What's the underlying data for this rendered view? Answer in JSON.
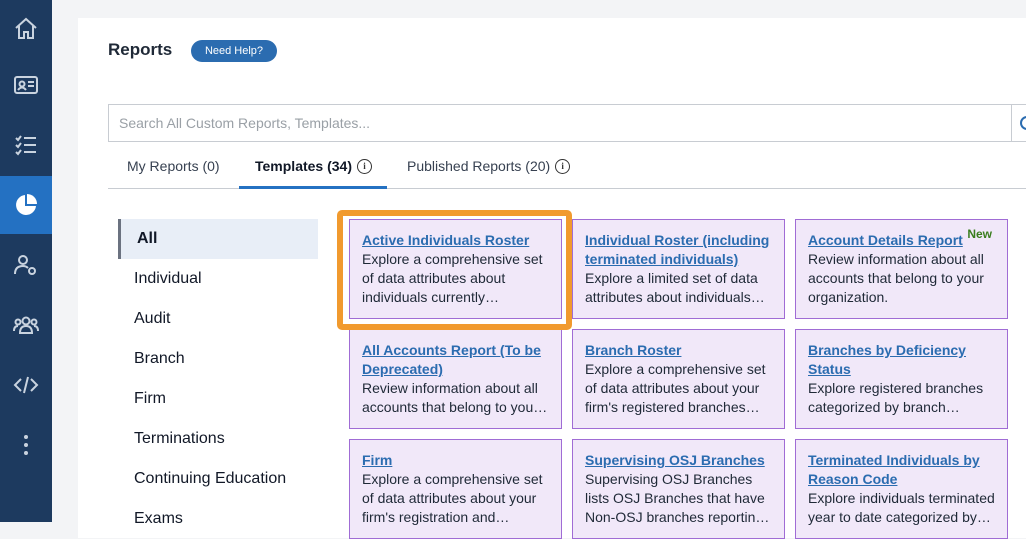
{
  "nav": {
    "items": [
      {
        "icon": "home-icon"
      },
      {
        "icon": "id-card-icon"
      },
      {
        "icon": "checklist-icon"
      },
      {
        "icon": "pie-chart-icon"
      },
      {
        "icon": "user-settings-icon"
      },
      {
        "icon": "users-group-icon"
      },
      {
        "icon": "code-icon"
      },
      {
        "icon": "more-vertical-icon"
      }
    ],
    "active_color": "#2471c2",
    "bg_color": "#1d3a5f"
  },
  "header": {
    "title": "Reports",
    "help_label": "Need Help?"
  },
  "search": {
    "placeholder": "Search All Custom Reports, Templates...",
    "value": ""
  },
  "tabs": [
    {
      "label": "My Reports (0)",
      "info": false
    },
    {
      "label": "Templates (34)",
      "info": true
    },
    {
      "label": "Published Reports (20)",
      "info": true
    }
  ],
  "categories": [
    "All",
    "Individual",
    "Audit",
    "Branch",
    "Firm",
    "Terminations",
    "Continuing Education",
    "Exams"
  ],
  "cards": [
    {
      "title": "Active Individuals Roster",
      "desc": "Explore a comprehensive set of data attributes about individuals currently…",
      "badge": ""
    },
    {
      "title": "Individual Roster (including terminated individuals)",
      "desc": "Explore a limited set of data attributes about individuals…",
      "badge": ""
    },
    {
      "title": "Account Details Report",
      "desc": "Review information about all accounts that belong to your organization.",
      "badge": "New"
    },
    {
      "title": "All Accounts Report (To be Deprecated)",
      "desc": "Review information about all accounts that belong to you…",
      "badge": ""
    },
    {
      "title": "Branch Roster",
      "desc": "Explore a comprehensive set of data attributes about your firm's registered branches…",
      "badge": ""
    },
    {
      "title": "Branches by Deficiency Status",
      "desc": "Explore registered branches categorized by branch…",
      "badge": ""
    },
    {
      "title": "Firm",
      "desc": "Explore a comprehensive set of data attributes about your firm's registration and…",
      "badge": ""
    },
    {
      "title": "Supervising OSJ Branches",
      "desc": "Supervising OSJ Branches lists OSJ Branches that have Non-OSJ branches reportin…",
      "badge": ""
    },
    {
      "title": "Terminated Individuals by Reason Code",
      "desc": "Explore individuals terminated year to date categorized by…",
      "badge": ""
    }
  ]
}
